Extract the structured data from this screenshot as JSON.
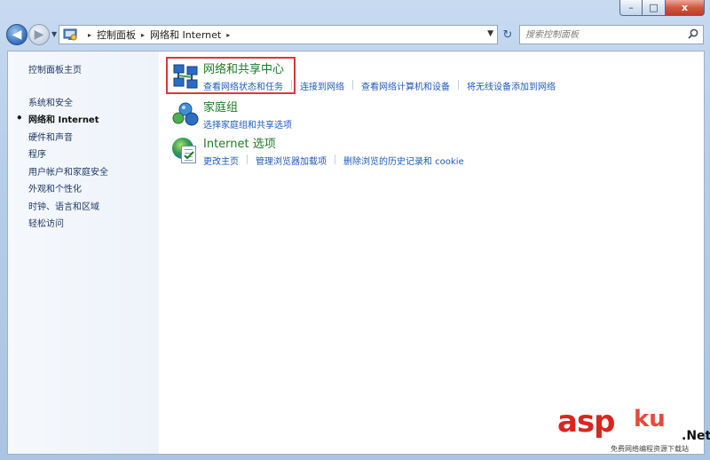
{
  "window": {
    "min_glyph": "–",
    "max_glyph": "□",
    "close_glyph": "x"
  },
  "nav": {
    "back_glyph": "◀",
    "forward_glyph": "▶",
    "recent_glyph": "▼",
    "breadcrumb": [
      "控制面板",
      "网络和 Internet"
    ],
    "sep_glyph": "▸",
    "drop_glyph": "▼",
    "refresh_glyph": "↻"
  },
  "search": {
    "placeholder": "搜索控制面板",
    "icon_glyph": "⌕"
  },
  "sidebar": {
    "items": [
      {
        "label": "控制面板主页"
      },
      {
        "label": "系统和安全"
      },
      {
        "label": "网络和 Internet",
        "current": true
      },
      {
        "label": "硬件和声音"
      },
      {
        "label": "程序"
      },
      {
        "label": "用户帐户和家庭安全"
      },
      {
        "label": "外观和个性化"
      },
      {
        "label": "时钟、语言和区域"
      },
      {
        "label": "轻松访问"
      }
    ]
  },
  "categories": [
    {
      "title": "网络和共享中心",
      "icon": "network-icon",
      "links": [
        "查看网络状态和任务",
        "连接到网络",
        "查看网络计算机和设备",
        "将无线设备添加到网络"
      ]
    },
    {
      "title": "家庭组",
      "icon": "homegroup-icon",
      "links": [
        "选择家庭组和共享选项"
      ]
    },
    {
      "title": "Internet 选项",
      "icon": "internet-options-icon",
      "links": [
        "更改主页",
        "管理浏览器加载项",
        "删除浏览的历史记录和 cookie"
      ]
    }
  ],
  "annotation": {
    "highlight_color": "#d63a3a"
  },
  "watermark": {
    "asp": "asp",
    "ku": "ku",
    "net": ".Net",
    "sub": "免费网络编程资源下载站"
  },
  "colors": {
    "link": "#1d5bbd",
    "category_title": "#1d7c24",
    "sidebar_text": "#1e3a66"
  }
}
